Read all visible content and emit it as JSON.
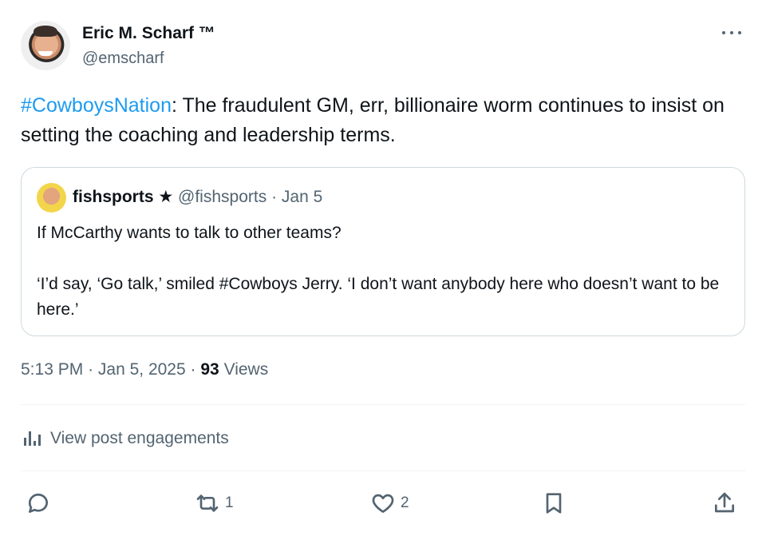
{
  "author": {
    "name": "Eric M. Scharf ™",
    "handle": "@emscharf"
  },
  "tweet": {
    "hashtag": "#CowboysNation",
    "text": ": The fraudulent GM, err, billionaire worm continues to insist on setting the coaching and leadership terms."
  },
  "quoted": {
    "name": "fishsports ★",
    "handle": "@fishsports",
    "separator": "·",
    "date": "Jan 5",
    "paragraphs": [
      "If McCarthy wants to talk to other teams?",
      "‘I’d say, ‘Go talk,’ smiled #Cowboys Jerry. ‘I don’t want anybody here who doesn’t want to be here.’"
    ]
  },
  "meta": {
    "time": "5:13 PM",
    "date": "Jan 5, 2025",
    "separator": "·",
    "views_count": "93",
    "views_label": "Views"
  },
  "engagements_label": "View post engagements",
  "actions": {
    "reply": {
      "icon": "reply-icon",
      "count": ""
    },
    "retweet": {
      "icon": "retweet-icon",
      "count": "1"
    },
    "like": {
      "icon": "heart-icon",
      "count": "2"
    },
    "bookmark": {
      "icon": "bookmark-icon",
      "count": ""
    },
    "share": {
      "icon": "share-icon",
      "count": ""
    }
  },
  "colors": {
    "hashtag": "#1d9bf0",
    "secondary_text": "#536471",
    "primary_text": "#0f1419",
    "border": "#cfd9de"
  }
}
